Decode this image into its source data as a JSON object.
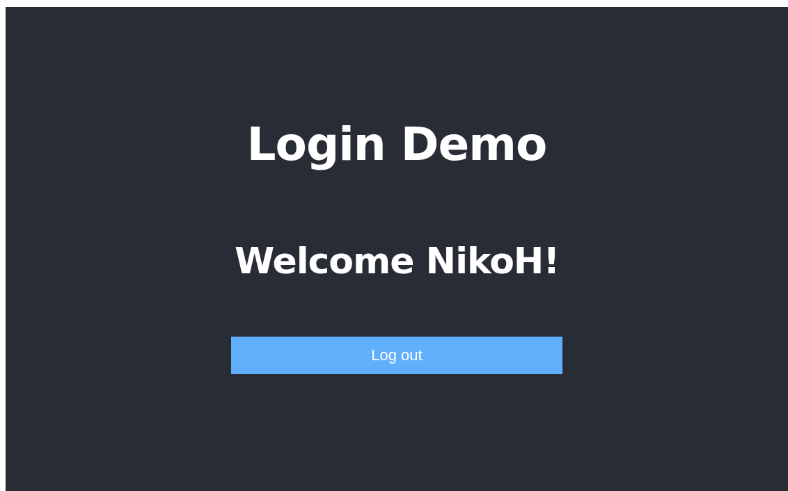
{
  "title": "Login Demo",
  "welcome": "Welcome NikoH!",
  "logout_button": {
    "label": "Log out"
  }
}
